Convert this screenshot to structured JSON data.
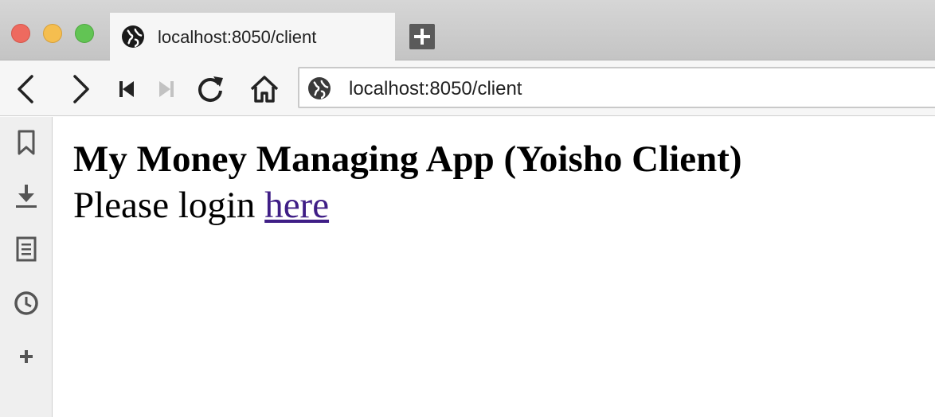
{
  "window": {
    "controls": [
      "close",
      "minimize",
      "maximize"
    ]
  },
  "tab": {
    "title": "localhost:8050/client",
    "icon": "globe-icon"
  },
  "toolbar": {
    "buttons": [
      "back-icon",
      "forward-icon",
      "skip-back-icon",
      "skip-forward-icon",
      "reload-icon",
      "home-icon"
    ],
    "url": "localhost:8050/client"
  },
  "sidebar": {
    "items": [
      "bookmark-icon",
      "download-icon",
      "reader-icon",
      "history-icon",
      "add-icon"
    ]
  },
  "page": {
    "heading": "My Money Managing App (Yoisho Client)",
    "login_prefix": "Please login ",
    "login_link": "here",
    "link_color": "#3f1e86"
  }
}
